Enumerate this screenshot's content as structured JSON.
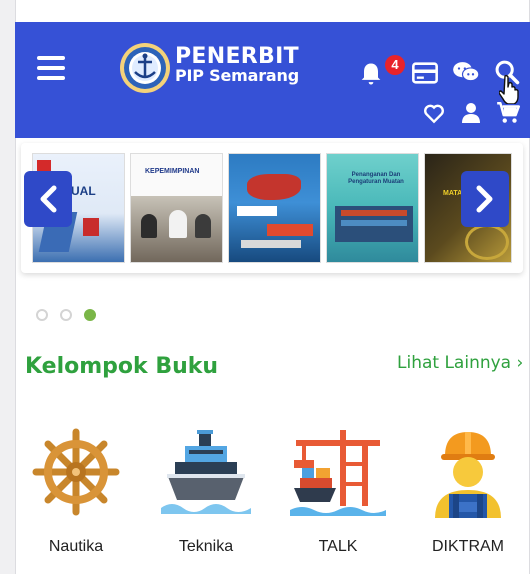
{
  "header": {
    "menu_icon": "hamburger-icon",
    "logo_icon": "anchor-seal-logo",
    "brand_title": "PENERBIT",
    "brand_subtitle": "PIP Semarang",
    "notification_count": "4",
    "icons": [
      "bell-icon",
      "card-icon",
      "chat-icon",
      "search-icon",
      "heart-icon",
      "user-icon",
      "cart-icon"
    ],
    "color": "#3651d6"
  },
  "carousel": {
    "slides": [
      {
        "title": "SUAL"
      },
      {
        "title": "KEPEMIMPINAN"
      },
      {
        "title": ""
      },
      {
        "title": "Penanganan Dan Pengaturan Muatan"
      },
      {
        "title": "MATA UNTUK"
      }
    ],
    "active_dot": 3,
    "dot_count": 3
  },
  "section": {
    "title": "Kelompok Buku",
    "see_all": "Lihat Lainnya ›",
    "accent": "#2fa13e"
  },
  "categories": [
    {
      "label": "Nautika",
      "icon": "ship-wheel-icon"
    },
    {
      "label": "Teknika",
      "icon": "ship-icon"
    },
    {
      "label": "TALK",
      "icon": "port-crane-icon"
    },
    {
      "label": "DIKTRAM",
      "icon": "worker-icon"
    }
  ]
}
